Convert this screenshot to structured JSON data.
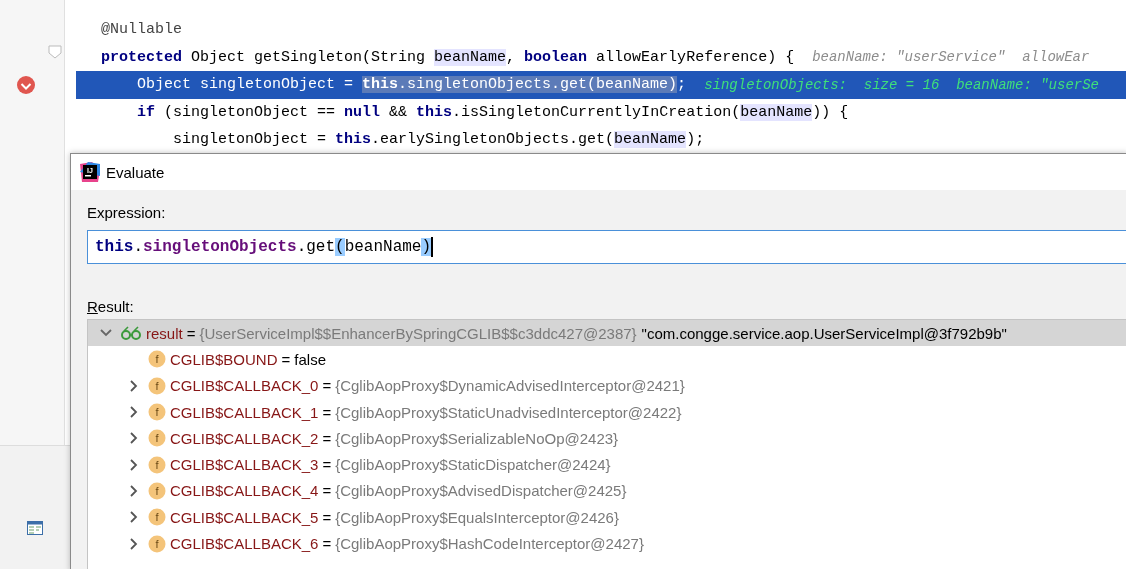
{
  "editor": {
    "lines": [
      {
        "selected": false,
        "breakpoint": false,
        "fold": false,
        "segments": [
          {
            "kind": "annotation",
            "text": "@Nullable"
          }
        ]
      },
      {
        "selected": false,
        "breakpoint": false,
        "fold": true,
        "segments": [
          {
            "kind": "keyword",
            "text": "protected"
          },
          {
            "kind": "plain",
            "text": " Object getSingleton(String "
          },
          {
            "kind": "param",
            "text": "beanName"
          },
          {
            "kind": "plain",
            "text": ", "
          },
          {
            "kind": "keyword",
            "text": "boolean"
          },
          {
            "kind": "plain",
            "text": " allowEarlyReference) {  "
          },
          {
            "kind": "hint",
            "text": "beanName: \"userService\"  allowEar"
          }
        ]
      },
      {
        "selected": true,
        "breakpoint": true,
        "fold": false,
        "segments": [
          {
            "kind": "plain",
            "text": "    Object singletonObject = "
          },
          {
            "kind": "sel-keyword",
            "text": "this"
          },
          {
            "kind": "sel-plain",
            "text": ".singletonObjects.get(beanName)"
          },
          {
            "kind": "plain",
            "text": ";  "
          },
          {
            "kind": "watch",
            "text": "singletonObjects:  size = 16  beanName: \"userSe"
          }
        ]
      },
      {
        "selected": false,
        "breakpoint": false,
        "fold": false,
        "segments": [
          {
            "kind": "keyword",
            "text": "    if"
          },
          {
            "kind": "plain",
            "text": " (singletonObject == "
          },
          {
            "kind": "keyword",
            "text": "null"
          },
          {
            "kind": "plain",
            "text": " && "
          },
          {
            "kind": "keyword",
            "text": "this"
          },
          {
            "kind": "plain",
            "text": ".isSingletonCurrentlyInCreation("
          },
          {
            "kind": "param",
            "text": "beanName"
          },
          {
            "kind": "plain",
            "text": ")) {"
          }
        ]
      },
      {
        "selected": false,
        "breakpoint": false,
        "fold": false,
        "segments": [
          {
            "kind": "plain",
            "text": "        singletonObject = "
          },
          {
            "kind": "keyword",
            "text": "this"
          },
          {
            "kind": "plain",
            "text": ".earlySingletonObjects.get("
          },
          {
            "kind": "param",
            "text": "beanName"
          },
          {
            "kind": "plain",
            "text": ");"
          }
        ]
      }
    ]
  },
  "dialog": {
    "logo_text": "IJ",
    "title": "Evaluate",
    "expression_label": "Expression:",
    "expression": [
      {
        "kind": "keyword",
        "text": "this"
      },
      {
        "kind": "plain",
        "text": "."
      },
      {
        "kind": "field",
        "text": "singletonObjects"
      },
      {
        "kind": "plain",
        "text": ".get"
      },
      {
        "kind": "brace",
        "text": "("
      },
      {
        "kind": "plain",
        "text": "beanName"
      },
      {
        "kind": "brace",
        "text": ")"
      }
    ],
    "result_label": "Result:",
    "result": {
      "kind": "result",
      "name": "result",
      "operator": "=",
      "value": "{UserServiceImpl$$EnhancerBySpringCGLIB$$c3ddc427@2387}",
      "value_is_object": true,
      "description": "\"com.congge.service.aop.UserServiceImpl@3f792b9b\"",
      "selected": true,
      "expandable": true,
      "expanded": true,
      "children": [
        {
          "kind": "field",
          "icon_text": "f",
          "name": "CGLIB$BOUND",
          "operator": "=",
          "value": "false",
          "value_is_object": false,
          "selected": false,
          "expandable": false,
          "expanded": false
        },
        {
          "kind": "field",
          "icon_text": "f",
          "name": "CGLIB$CALLBACK_0",
          "operator": "=",
          "value": "{CglibAopProxy$DynamicAdvisedInterceptor@2421}",
          "value_is_object": true,
          "selected": false,
          "expandable": true,
          "expanded": false
        },
        {
          "kind": "field",
          "icon_text": "f",
          "name": "CGLIB$CALLBACK_1",
          "operator": "=",
          "value": "{CglibAopProxy$StaticUnadvisedInterceptor@2422}",
          "value_is_object": true,
          "selected": false,
          "expandable": true,
          "expanded": false
        },
        {
          "kind": "field",
          "icon_text": "f",
          "name": "CGLIB$CALLBACK_2",
          "operator": "=",
          "value": "{CglibAopProxy$SerializableNoOp@2423}",
          "value_is_object": true,
          "selected": false,
          "expandable": true,
          "expanded": false
        },
        {
          "kind": "field",
          "icon_text": "f",
          "name": "CGLIB$CALLBACK_3",
          "operator": "=",
          "value": "{CglibAopProxy$StaticDispatcher@2424}",
          "value_is_object": true,
          "selected": false,
          "expandable": true,
          "expanded": false
        },
        {
          "kind": "field",
          "icon_text": "f",
          "name": "CGLIB$CALLBACK_4",
          "operator": "=",
          "value": "{CglibAopProxy$AdvisedDispatcher@2425}",
          "value_is_object": true,
          "selected": false,
          "expandable": true,
          "expanded": false
        },
        {
          "kind": "field",
          "icon_text": "f",
          "name": "CGLIB$CALLBACK_5",
          "operator": "=",
          "value": "{CglibAopProxy$EqualsInterceptor@2426}",
          "value_is_object": true,
          "selected": false,
          "expandable": true,
          "expanded": false
        },
        {
          "kind": "field",
          "icon_text": "f",
          "name": "CGLIB$CALLBACK_6",
          "operator": "=",
          "value": "{CglibAopProxy$HashCodeInterceptor@2427}",
          "value_is_object": true,
          "selected": false,
          "expandable": true,
          "expanded": false
        }
      ]
    }
  }
}
